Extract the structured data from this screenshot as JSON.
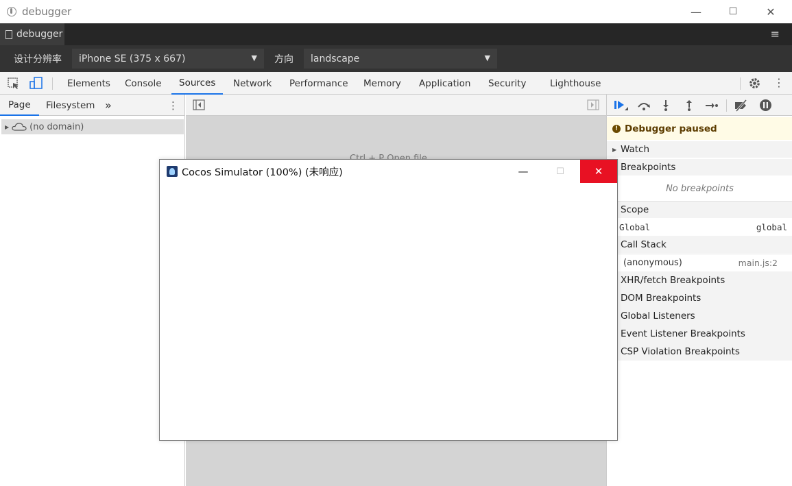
{
  "window": {
    "title": "debugger",
    "minimize": "—",
    "maximize": "☐",
    "close": "✕"
  },
  "tabbar": {
    "tab_label": "debugger",
    "menu_icon": "≡"
  },
  "device": {
    "resolution_label": "设计分辨率",
    "resolution_value": "iPhone SE (375 x 667)",
    "orientation_label": "方向",
    "orientation_value": "landscape",
    "dropdown_arrow": "▼"
  },
  "devtools_tabs": [
    "Elements",
    "Console",
    "Sources",
    "Network",
    "Performance",
    "Memory",
    "Application",
    "Security",
    "Lighthouse"
  ],
  "active_tab": "Sources",
  "navigator": {
    "tabs": [
      "Page",
      "Filesystem"
    ],
    "more": "»",
    "kebab": "⋮",
    "tree_item": "(no domain)"
  },
  "editor": {
    "background_text": "Ctrl + P Open file"
  },
  "debugger": {
    "paused_text": "Debugger paused",
    "watch": "Watch",
    "breakpoints": "Breakpoints",
    "no_breakpoints": "No breakpoints",
    "scope": "Scope",
    "scope_row": {
      "name": "Global",
      "value": "global"
    },
    "call_stack": "Call Stack",
    "call_frame": {
      "name": "(anonymous)",
      "location": "main.js:2"
    },
    "xhr": "XHR/fetch Breakpoints",
    "dom": "DOM Breakpoints",
    "global_listeners": "Global Listeners",
    "event_listener": "Event Listener Breakpoints",
    "csp": "CSP Violation Breakpoints"
  },
  "simulator": {
    "title": "Cocos Simulator (100%) (未响应)",
    "min": "—",
    "max": "☐",
    "close": "✕"
  },
  "colors": {
    "accent": "#1a73e8",
    "close_red": "#e81123",
    "paused_bg": "#fffbe6"
  }
}
